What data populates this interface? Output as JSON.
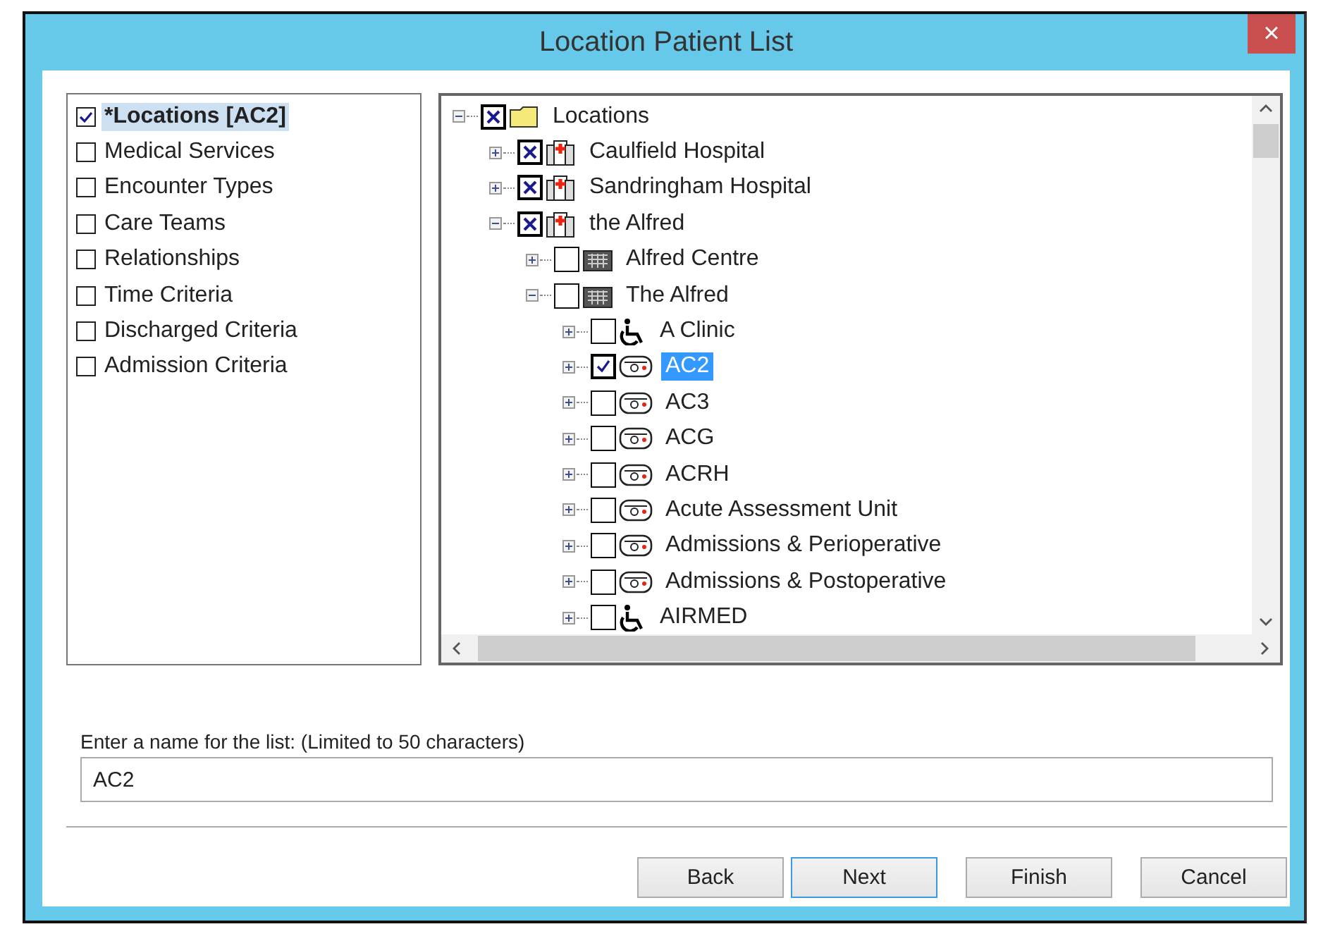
{
  "window": {
    "title": "Location Patient List",
    "close_glyph": "×"
  },
  "criteria": [
    {
      "label": "*Locations [AC2]",
      "checked": true,
      "selected": true
    },
    {
      "label": "Medical Services",
      "checked": false,
      "selected": false
    },
    {
      "label": "Encounter Types",
      "checked": false,
      "selected": false
    },
    {
      "label": "Care Teams",
      "checked": false,
      "selected": false
    },
    {
      "label": "Relationships",
      "checked": false,
      "selected": false
    },
    {
      "label": "Time Criteria",
      "checked": false,
      "selected": false
    },
    {
      "label": "Discharged Criteria",
      "checked": false,
      "selected": false
    },
    {
      "label": "Admission Criteria",
      "checked": false,
      "selected": false
    }
  ],
  "tree": [
    {
      "label": "Locations",
      "kind": "folder",
      "expanded": true,
      "checked": true,
      "crossed": true,
      "selected": false,
      "children": [
        {
          "label": "Caulfield Hospital",
          "kind": "hospital",
          "expanded": false,
          "checked": true,
          "crossed": true,
          "selected": false
        },
        {
          "label": "Sandringham Hospital",
          "kind": "hospital",
          "expanded": false,
          "checked": true,
          "crossed": true,
          "selected": false
        },
        {
          "label": "the Alfred",
          "kind": "hospital",
          "expanded": true,
          "checked": true,
          "crossed": true,
          "selected": false,
          "children": [
            {
              "label": "Alfred Centre",
              "kind": "building",
              "expanded": false,
              "checked": false,
              "crossed": false,
              "selected": false
            },
            {
              "label": "The Alfred",
              "kind": "building",
              "expanded": true,
              "checked": false,
              "crossed": false,
              "selected": false,
              "children": [
                {
                  "label": "A Clinic",
                  "kind": "clinic",
                  "expanded": false,
                  "checked": false,
                  "crossed": false,
                  "selected": false
                },
                {
                  "label": "AC2",
                  "kind": "ward",
                  "expanded": false,
                  "checked": true,
                  "crossed": false,
                  "selected": true
                },
                {
                  "label": "AC3",
                  "kind": "ward",
                  "expanded": false,
                  "checked": false,
                  "crossed": false,
                  "selected": false
                },
                {
                  "label": "ACG",
                  "kind": "ward",
                  "expanded": false,
                  "checked": false,
                  "crossed": false,
                  "selected": false
                },
                {
                  "label": "ACRH",
                  "kind": "ward",
                  "expanded": false,
                  "checked": false,
                  "crossed": false,
                  "selected": false
                },
                {
                  "label": "Acute Assessment Unit",
                  "kind": "ward",
                  "expanded": false,
                  "checked": false,
                  "crossed": false,
                  "selected": false
                },
                {
                  "label": "Admissions & Perioperative",
                  "kind": "ward",
                  "expanded": false,
                  "checked": false,
                  "crossed": false,
                  "selected": false
                },
                {
                  "label": "Admissions & Postoperative",
                  "kind": "ward",
                  "expanded": false,
                  "checked": false,
                  "crossed": false,
                  "selected": false
                },
                {
                  "label": "AIRMED",
                  "kind": "clinic",
                  "expanded": false,
                  "checked": false,
                  "crossed": false,
                  "selected": false
                }
              ]
            }
          ]
        }
      ]
    }
  ],
  "name_field": {
    "label": "Enter a name for the list: (Limited to 50 characters)",
    "value": "AC2"
  },
  "buttons": [
    {
      "label": "Back",
      "selected": false
    },
    {
      "label": "Next",
      "selected": true
    },
    {
      "label": "Finish",
      "selected": false
    },
    {
      "label": "Cancel",
      "selected": false
    }
  ]
}
